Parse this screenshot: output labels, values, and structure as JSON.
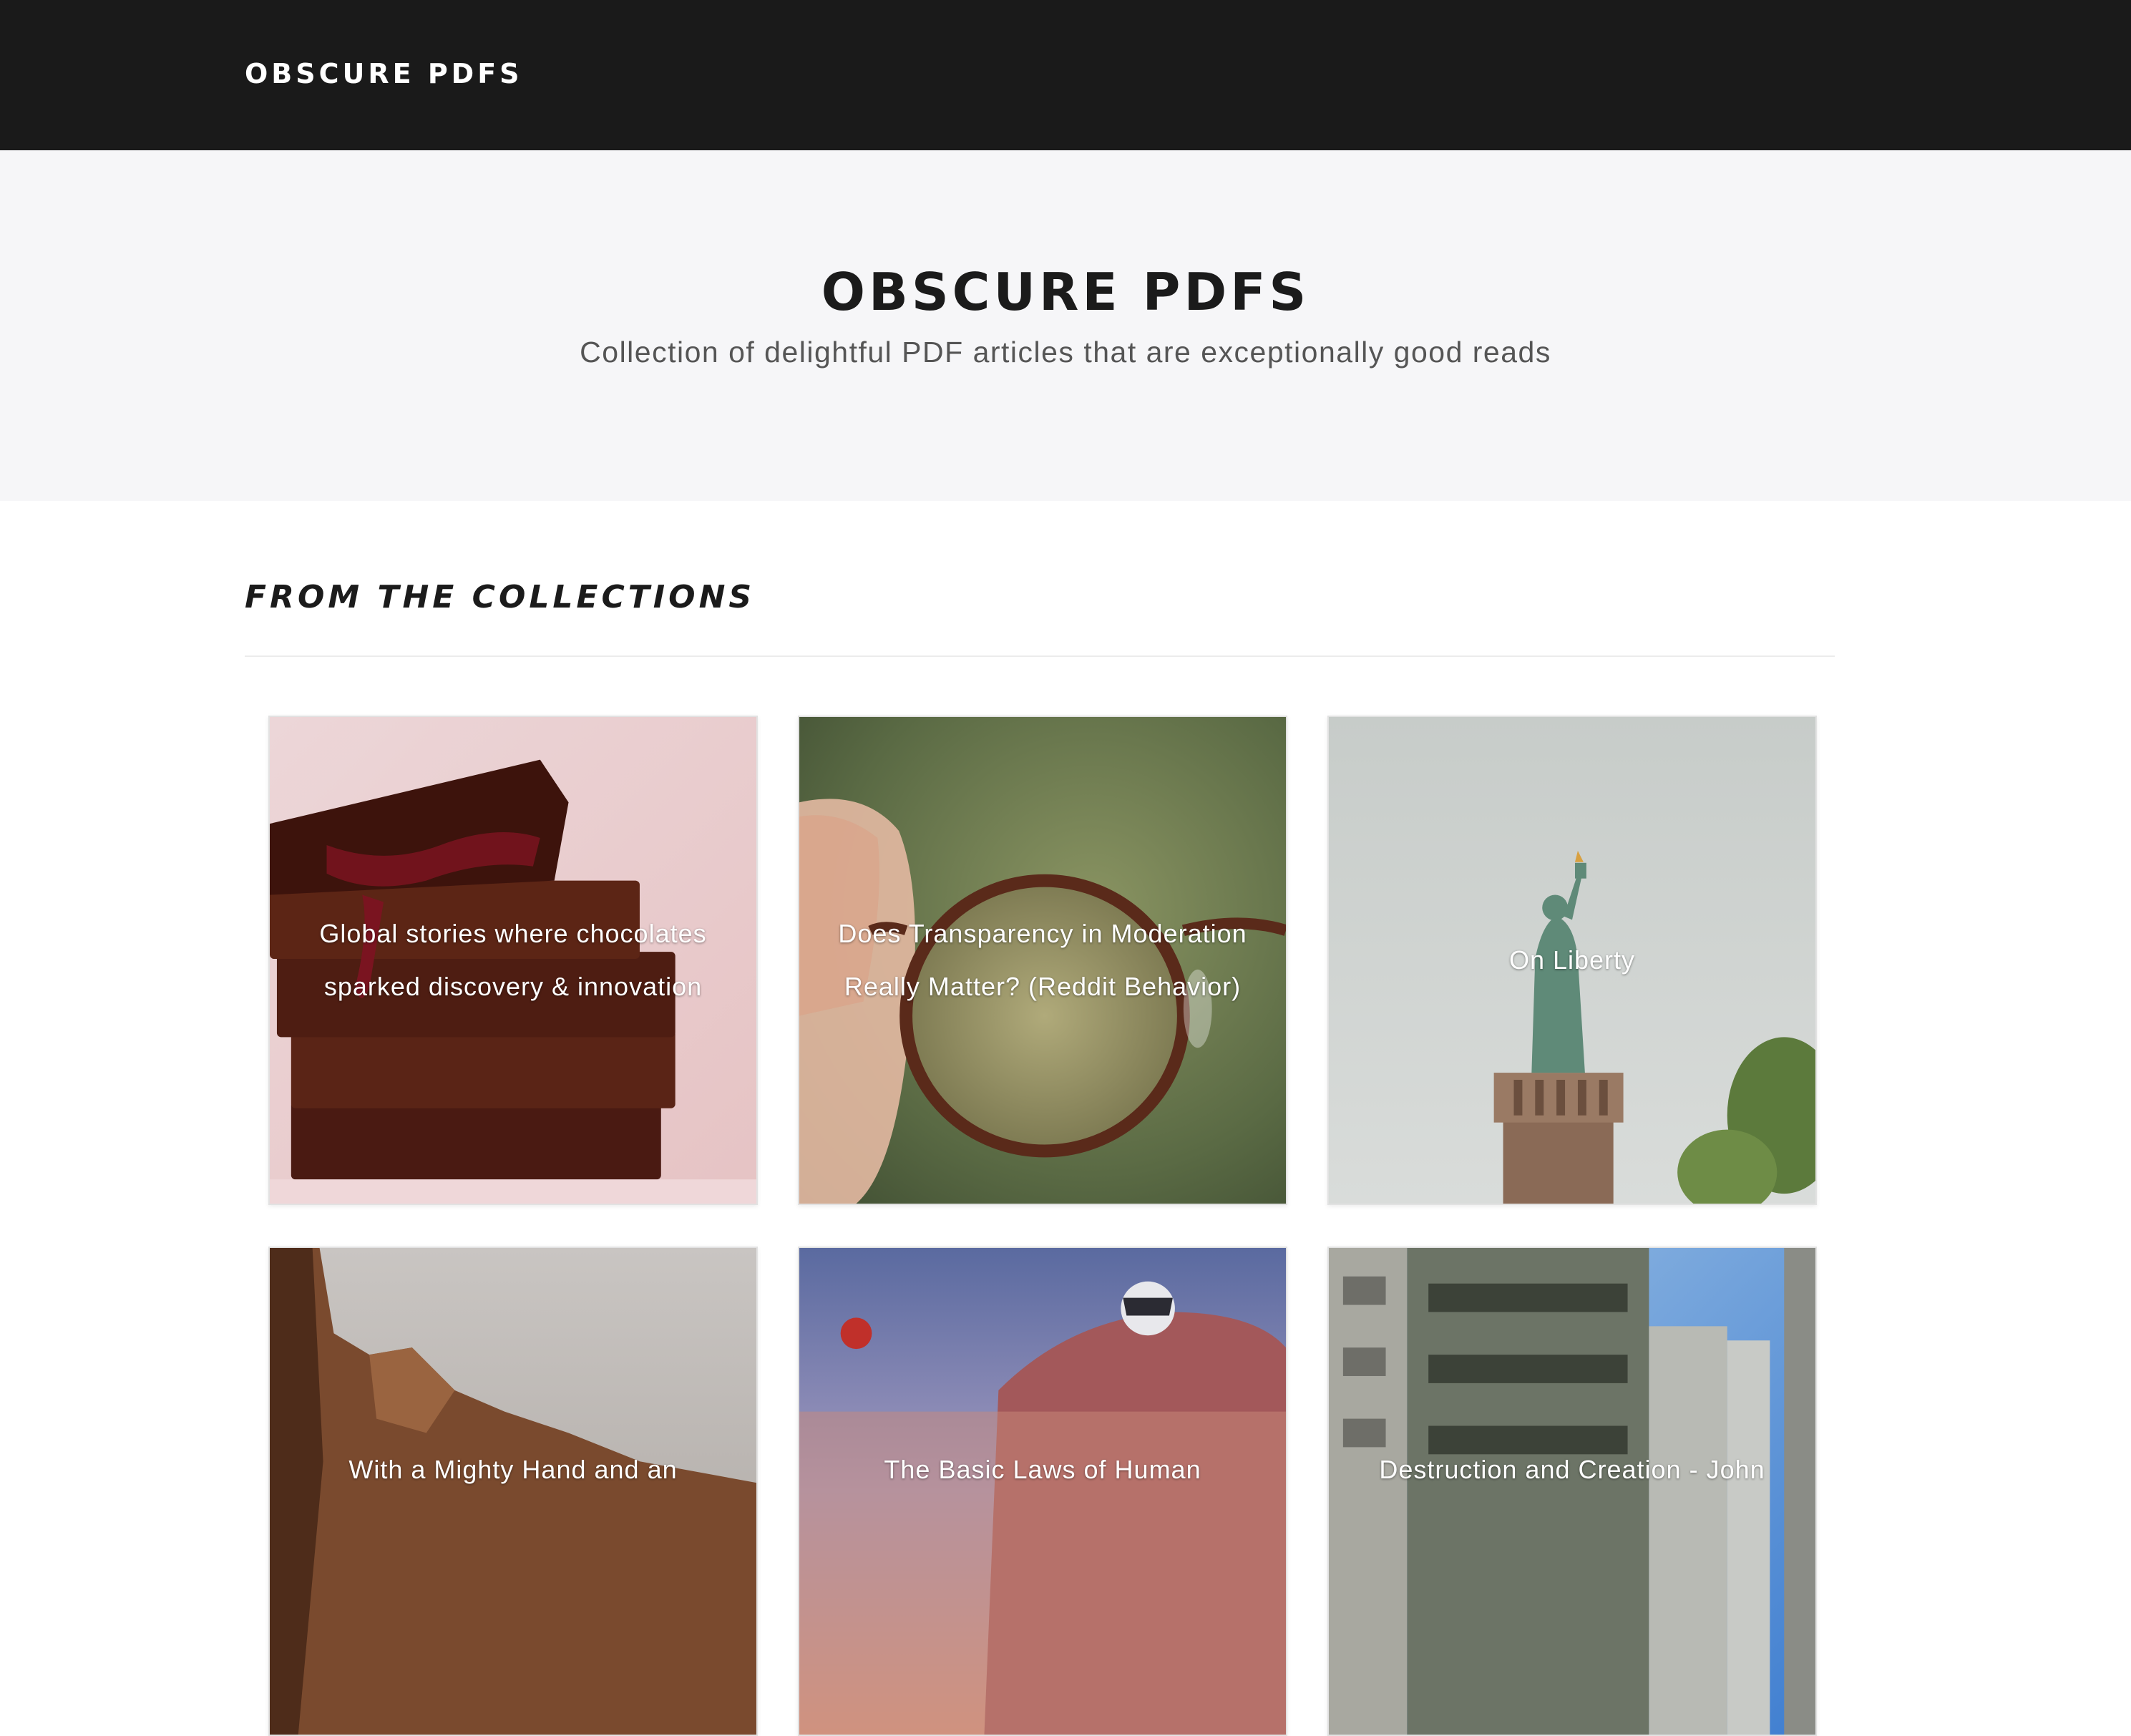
{
  "navbar": {
    "brand": "OBSCURE PDFS"
  },
  "hero": {
    "title": "OBSCURE PDFS",
    "subtitle": "Collection of delightful PDF articles that are exceptionally good reads"
  },
  "section": {
    "heading": "FROM THE COLLECTIONS"
  },
  "cards": [
    {
      "title": "Global stories where chocolates sparked discovery & innovation",
      "image": "chocolate-bars-image"
    },
    {
      "title": "Does Transparency in Moderation Really Matter? (Reddit Behavior)",
      "image": "eyeglasses-image"
    },
    {
      "title": "On Liberty",
      "image": "statue-of-liberty-image"
    },
    {
      "title": "With a Mighty Hand and an",
      "image": "desert-cliffs-image"
    },
    {
      "title": "The Basic Laws of Human",
      "image": "motorcyclists-image"
    },
    {
      "title": "Destruction and Creation - John",
      "image": "abandoned-building-image"
    }
  ],
  "colors": {
    "navbar_bg": "#1a1a1a",
    "hero_bg": "#f6f6f8",
    "heading_text": "#1b1b1b",
    "subtitle_text": "#555555"
  }
}
